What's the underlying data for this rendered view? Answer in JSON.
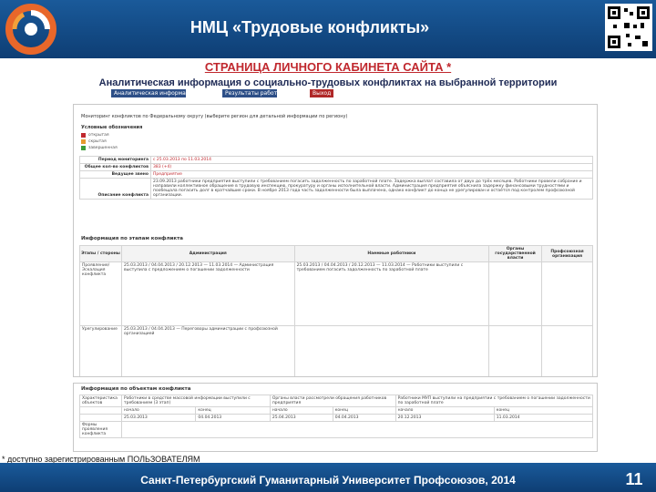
{
  "header": {
    "title": "НМЦ «Трудовые конфликты»"
  },
  "page": {
    "heading": "СТРАНИЦА ЛИЧНОГО КАБИНЕТА САЙТА *",
    "subheading": "Аналитическая информация о социально-трудовых конфликтах на выбранной территории"
  },
  "tabs": [
    {
      "label": "Аналитическая информация"
    },
    {
      "label": "Результаты работы"
    },
    {
      "label": "Выход"
    }
  ],
  "panel": {
    "intro": "Мониторинг конфликтов по Федеральному округу (выберите регион для детальной информации по региону)",
    "legend": {
      "title": "Условные обозначения",
      "items": [
        {
          "label": "открытая",
          "color": "#c0282e"
        },
        {
          "label": "скрытая",
          "color": "#e69a2e"
        },
        {
          "label": "завершенная",
          "color": "#3d9c3a"
        }
      ]
    },
    "info": {
      "rows": [
        {
          "label": "Период мониторинга",
          "value": "с 25.03.2013 по 11.03.2014",
          "red": true
        },
        {
          "label": "Общее кол-во конфликтов",
          "value": "383 (+4)",
          "red": true
        },
        {
          "label": "Ведущее звено",
          "value": "Предприятие",
          "red": true
        },
        {
          "label": "Описание конфликта",
          "value": "23.09.2013 работники предприятия выступили с требованием погасить задолженность по заработной плате. Задержка выплат составила от двух до трёх месяцев. Работники провели собрание и направили коллективное обращение в трудовую инспекцию, прокуратуру и органы исполнительной власти. Администрация предприятия объяснила задержку финансовыми трудностями и пообещала погасить долг в кратчайшие сроки. В ноябре 2013 года часть задолженности была выплачена, однако конфликт до конца не урегулирован и остаётся под контролем профсоюзной организации.",
          "red": false
        }
      ]
    },
    "section1": "Информация по этапам конфликта",
    "columns": [
      "Этапы / стороны",
      "Администрация",
      "Наемные работники",
      "Органы государственной власти",
      "Профсоюзная организация"
    ],
    "rows": [
      {
        "stage": "Проявление/Эскалация конфликта",
        "admin": "25.03.2013 / 04.04.2013 / 20.12.2013 — 11.03.2014 — Администрация выступила с предложением о погашении задолженности",
        "workers": "25.03.2013 / 04.04.2013 / 20.12.2013 — 11.03.2014 — Работники выступили с требованием погасить задолженность по заработной плате"
      },
      {
        "stage": "Урегулирование",
        "admin": "25.03.2013 / 04.04.2013 — Переговоры администрации с профсоюзной организацией",
        "workers": ""
      }
    ],
    "section2": "Информация по объектам конфликта",
    "info2": {
      "label1": "Характеристика объектов",
      "text1": "Работники в средстве массовой информации выступили с требованием (3 этап)",
      "text2": "Органы власти рассмотрели обращения работников предприятия",
      "text3": "Работники МУП выступили на предприятии с требованием о погашении задолженности по заработной плате",
      "dates": [
        "25.03.2013",
        "04.04.2013",
        "25.04.2013",
        "04.04.2013",
        "20.12.2013",
        "11.03.2014"
      ],
      "headers": [
        "начало",
        "конец",
        "начало",
        "конец",
        "начало",
        "конец"
      ],
      "label2": "Формы проявления конфликта"
    }
  },
  "footnote": "* доступно зарегистрированным ПОЛЬЗОВАТЕЛЯМ",
  "footer": {
    "text": "Санкт-Петербургский Гуманитарный Университет Профсоюзов, 2014",
    "page_number": "11"
  }
}
